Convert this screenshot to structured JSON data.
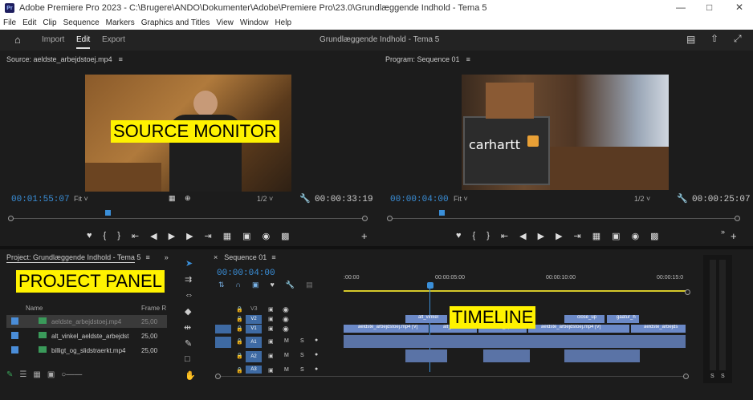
{
  "window": {
    "title": "Adobe Premiere Pro 2023 - C:\\Brugere\\ANDO\\Dokumenter\\Adobe\\Premiere Pro\\23.0\\Grundlæggende Indhold - Tema 5",
    "app_icon": "Pr"
  },
  "menu": [
    "File",
    "Edit",
    "Clip",
    "Sequence",
    "Markers",
    "Graphics and Titles",
    "View",
    "Window",
    "Help"
  ],
  "header": {
    "tabs": [
      "Import",
      "Edit",
      "Export"
    ],
    "active_tab": "Edit",
    "project_title": "Grundlæggende Indhold - Tema 5"
  },
  "source": {
    "panel_title": "Source: aeldste_arbejdstoej.mp4",
    "label": "SOURCE MONITOR",
    "timecode": "00:01:55:07",
    "fit": "Fit",
    "resolution": "1/2",
    "duration": "00:00:33:19"
  },
  "program": {
    "panel_title": "Program: Sequence 01",
    "timecode": "00:00:04:00",
    "fit": "Fit",
    "resolution": "1/2",
    "duration": "00:00:25:07",
    "sign_text": "carhartt"
  },
  "project": {
    "panel_title": "Project: Grundlæggende Indhold - Tema 5",
    "label": "PROJECT PANEL",
    "columns": [
      "Name",
      "Frame R"
    ],
    "items": [
      {
        "name": "aeldste_arbejdstoej.mp4",
        "rate": "25,00"
      },
      {
        "name": "alt_vinkel_aeldste_arbejdst",
        "rate": "25,00"
      },
      {
        "name": "billigt_og_slidstraerkt.mp4",
        "rate": "25,00"
      }
    ]
  },
  "timeline": {
    "panel_title": "Sequence 01",
    "label": "TIMELINE",
    "timecode": "00:00:04:00",
    "ruler": [
      ":00:00",
      "00:00:05:00",
      "00:00:10:00",
      "00:00:15:0"
    ],
    "tracks": [
      "V3",
      "V2",
      "V1",
      "A1",
      "A2",
      "A3"
    ],
    "clips_v1": [
      "aeldste_arbejdstoej.mp4 [V]",
      "alt_vinkel",
      "close_up",
      "aeldste_arbejdstoej.mp4 [V]",
      "aeldste_arbejds"
    ],
    "clips_v2": [
      "alt_vinkel",
      "close_up",
      "gaatur_h"
    ],
    "toggles": [
      "M",
      "S"
    ]
  },
  "meter": {
    "labels": [
      "S",
      "S"
    ]
  },
  "icons": [
    "home-icon",
    "share-icon",
    "fullscreen-icon",
    "play-icon",
    "wrench-icon",
    "hand-icon",
    "pen-icon",
    "razor-icon",
    "selection-icon"
  ]
}
